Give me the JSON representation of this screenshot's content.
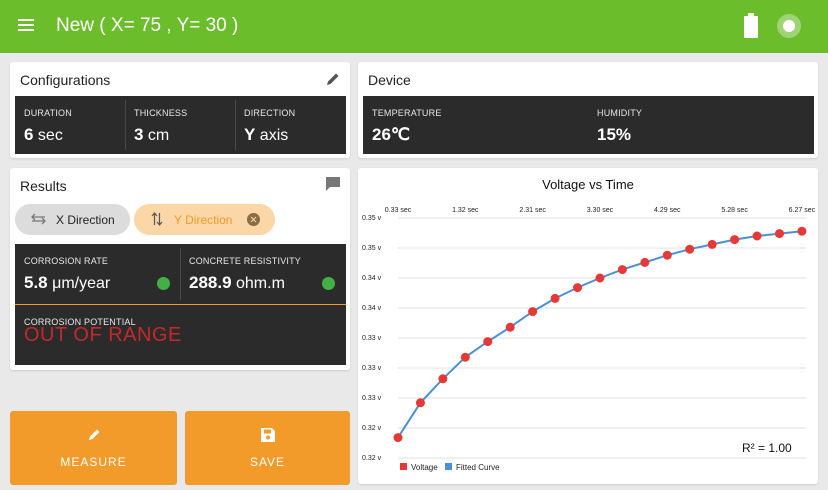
{
  "header": {
    "title": "New ( X= 75 , Y= 30 )",
    "menu_icon": "menu-icon",
    "battery_icon": "battery-icon",
    "status_icon": "status-indicator-icon"
  },
  "configurations": {
    "title": "Configurations",
    "duration": {
      "label": "DURATION",
      "value": "6",
      "unit": "sec"
    },
    "thickness": {
      "label": "THICKNESS",
      "value": "3",
      "unit": "cm"
    },
    "direction": {
      "label": "DIRECTION",
      "value": "Y",
      "unit": "axis"
    }
  },
  "device": {
    "title": "Device",
    "temperature": {
      "label": "TEMPERATURE",
      "value": "26℃"
    },
    "humidity": {
      "label": "HUMIDITY",
      "value": "15%"
    }
  },
  "results": {
    "title": "Results",
    "chips": {
      "x_label": "X Direction",
      "y_label": "Y Direction"
    },
    "corrosion_rate": {
      "label": "CORROSION RATE",
      "value": "5.8",
      "unit": "μm/year"
    },
    "resistivity": {
      "label": "CONCRETE RESISTIVITY",
      "value": "288.9",
      "unit": "ohm.m"
    },
    "potential": {
      "label": "CORROSION POTENTIAL",
      "value": "OUT OF RANGE"
    }
  },
  "actions": {
    "measure_label": "MEASURE",
    "save_label": "SAVE"
  },
  "colors": {
    "appbar": "#6bbd2c",
    "accent": "#f29b2a",
    "panel": "#2b2b2b",
    "ok": "#43b047",
    "error": "#c62828",
    "voltage": "#e53935",
    "fitted": "#4a90d9"
  },
  "chart_data": {
    "type": "line",
    "title": "Voltage vs Time",
    "x_tick_labels": [
      "0.33 sec",
      "1.32 sec",
      "2.31 sec",
      "3.30 sec",
      "4.29 sec",
      "5.28 sec",
      "6.27 sec"
    ],
    "x_ticks": [
      0.33,
      1.32,
      2.31,
      3.3,
      4.29,
      5.28,
      6.27
    ],
    "y_tick_labels": [
      "0.35 v",
      "0.35 v",
      "0.34 v",
      "0.34 v",
      "0.33 v",
      "0.33 v",
      "0.33 v",
      "0.32 v",
      "0.32 v"
    ],
    "y_ticks": [
      0.3525,
      0.35,
      0.3475,
      0.345,
      0.3425,
      0.34,
      0.3375,
      0.335,
      0.3325
    ],
    "xlim": [
      0.33,
      6.33
    ],
    "ylim": [
      0.3325,
      0.3525
    ],
    "grid": true,
    "legend_position": "bottom-left",
    "annotation": "R² = 1.00",
    "series": [
      {
        "name": "Voltage",
        "style": "points",
        "x": [
          0.33,
          0.66,
          0.99,
          1.32,
          1.65,
          1.98,
          2.31,
          2.64,
          2.97,
          3.3,
          3.63,
          3.96,
          4.29,
          4.62,
          4.95,
          5.28,
          5.61,
          5.94,
          6.27
        ],
        "y": [
          0.3342,
          0.3371,
          0.3391,
          0.3409,
          0.3422,
          0.3434,
          0.3447,
          0.3458,
          0.3467,
          0.3475,
          0.3482,
          0.3488,
          0.3494,
          0.3499,
          0.3503,
          0.3507,
          0.351,
          0.3512,
          0.3514
        ]
      },
      {
        "name": "Fitted Curve",
        "style": "line",
        "x": [
          0.33,
          0.66,
          0.99,
          1.32,
          1.65,
          1.98,
          2.31,
          2.64,
          2.97,
          3.3,
          3.63,
          3.96,
          4.29,
          4.62,
          4.95,
          5.28,
          5.61,
          5.94,
          6.27
        ],
        "y": [
          0.3342,
          0.3371,
          0.3391,
          0.3409,
          0.3422,
          0.3434,
          0.3447,
          0.3458,
          0.3467,
          0.3475,
          0.3482,
          0.3488,
          0.3494,
          0.3499,
          0.3503,
          0.3507,
          0.351,
          0.3512,
          0.3514
        ]
      }
    ]
  }
}
